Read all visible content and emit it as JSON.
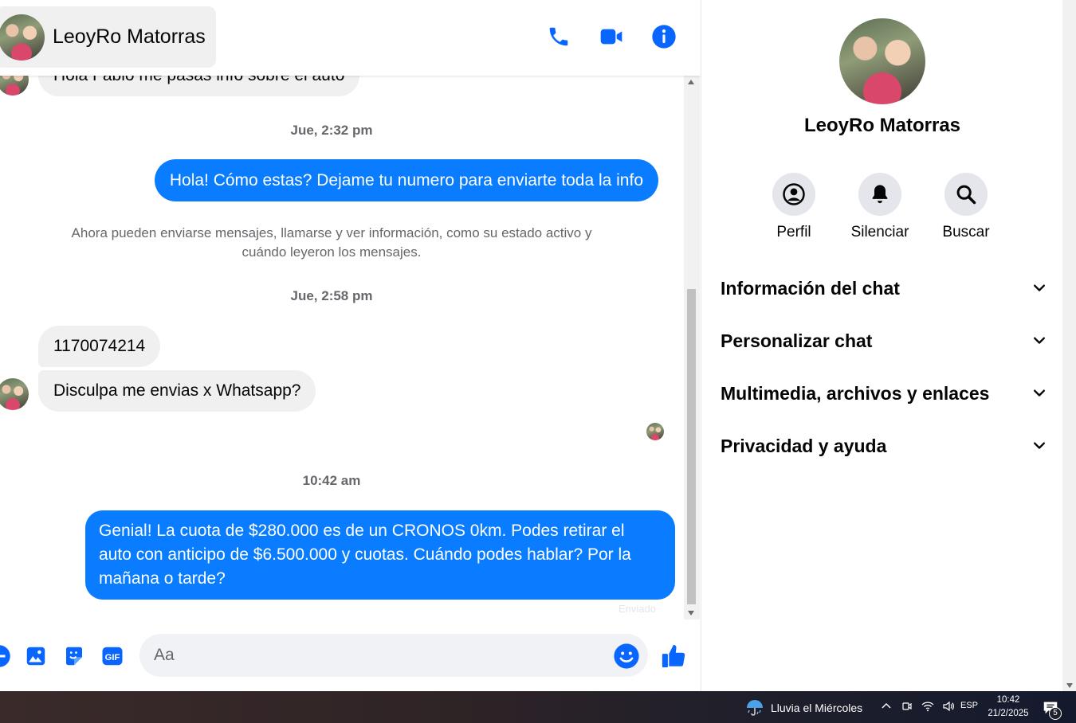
{
  "header": {
    "contact_name": "LeoyRo Matorras"
  },
  "messages": {
    "cut_top_message": "Hola Fabio me pasas info sobre el auto",
    "timestamp_1": "Jue, 2:32 pm",
    "outgoing_1": "Hola! Cómo estas? Dejame tu numero para enviarte toda la info",
    "system_note": "Ahora pueden enviarse mensajes, llamarse y ver información, como su estado activo y cuándo leyeron los mensajes.",
    "timestamp_2": "Jue, 2:58 pm",
    "incoming_1": "1170074214",
    "incoming_2": "Disculpa me envias x Whatsapp?",
    "timestamp_3": "10:42 am",
    "outgoing_2": "Genial! La cuota de $280.000 es de un CRONOS 0km. Podes retirar el auto con anticipo de $6.500.000 y cuotas. Cuándo podes hablar? Por la mañana o tarde?",
    "sent_status": "Enviado"
  },
  "composer": {
    "placeholder": "Aa"
  },
  "panel": {
    "name": "LeoyRo Matorras",
    "actions": [
      {
        "label": "Perfil",
        "icon": "profile-icon"
      },
      {
        "label": "Silenciar",
        "icon": "bell-icon"
      },
      {
        "label": "Buscar",
        "icon": "search-icon"
      }
    ],
    "sections": [
      "Información del chat",
      "Personalizar chat",
      "Multimedia, archivos y enlaces",
      "Privacidad y ayuda"
    ]
  },
  "taskbar": {
    "weather": "Lluvia el Miércoles",
    "language": "ESP",
    "time": "10:42",
    "date": "21/2/2025",
    "notification_count": "5"
  },
  "colors": {
    "accent": "#0a7cff",
    "incoming_bubble": "#f0f0f0",
    "icon_blue": "#0866ff"
  }
}
